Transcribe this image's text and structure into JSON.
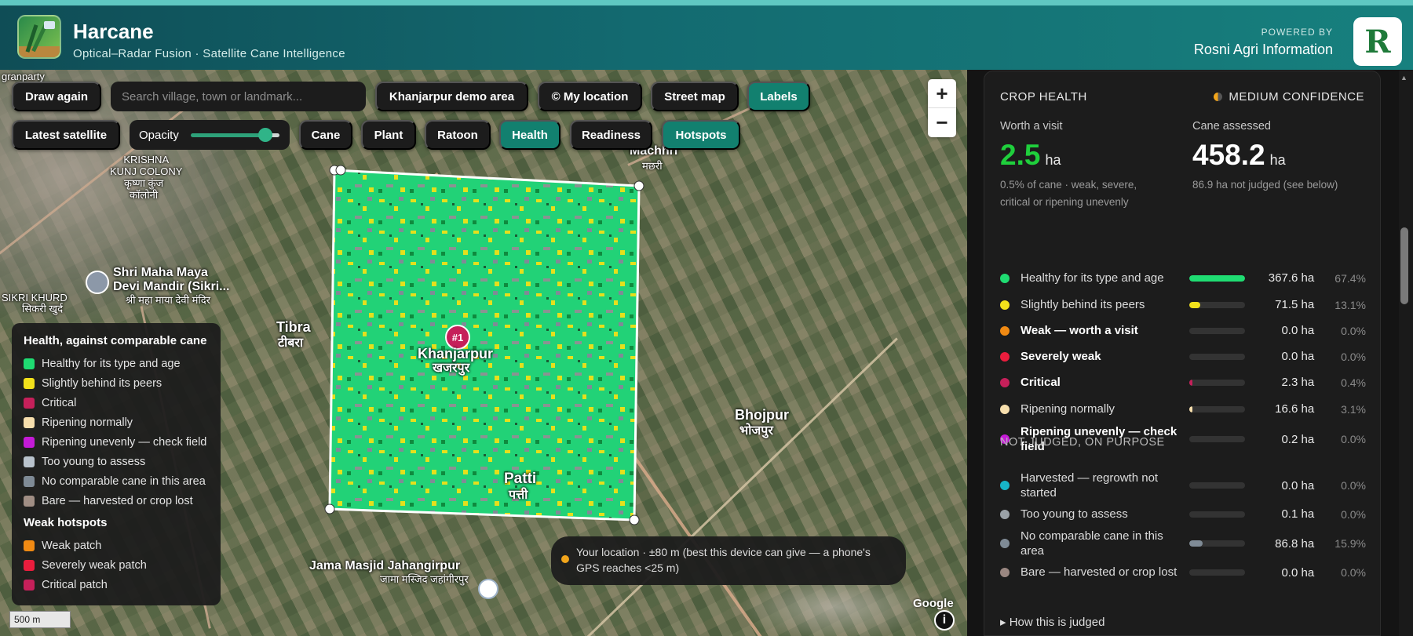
{
  "header": {
    "title": "Harcane",
    "subtitle": "Optical–Radar Fusion · Satellite Cane Intelligence",
    "powered_by": "POWERED BY",
    "company": "Rosni Agri Information",
    "brand_mark": "R"
  },
  "toolbar": {
    "draw_again": "Draw again",
    "search_placeholder": "Search village, town or landmark...",
    "demo_area": "Khanjarpur demo area",
    "my_location": "© My location",
    "street_map": "Street map",
    "labels": "Labels",
    "latest_satellite": "Latest satellite",
    "opacity_label": "Opacity",
    "opacity_value": 0.85,
    "layers": [
      "Cane",
      "Plant",
      "Ratoon",
      "Health",
      "Readiness",
      "Hotspots"
    ],
    "active_layers": [
      "Labels",
      "Health",
      "Hotspots"
    ]
  },
  "zoom": {
    "in": "+",
    "out": "−"
  },
  "legend": {
    "title": "Health, against comparable cane",
    "items": [
      {
        "label": "Healthy for its type and age",
        "color": "#1fdc72"
      },
      {
        "label": "Slightly behind its peers",
        "color": "#f2e11b"
      },
      {
        "label": "Critical",
        "color": "#c5205a"
      },
      {
        "label": "Ripening normally",
        "color": "#f7dfad"
      },
      {
        "label": "Ripening unevenly — check field",
        "color": "#c41bd6"
      },
      {
        "label": "Too young to assess",
        "color": "#b9c3cc"
      },
      {
        "label": "No comparable cane in this area",
        "color": "#7f8b96"
      },
      {
        "label": "Bare — harvested or crop lost",
        "color": "#a08e84"
      }
    ],
    "hotspots_title": "Weak hotspots",
    "hotspots": [
      {
        "label": "Weak patch",
        "color": "#f08a13"
      },
      {
        "label": "Severely weak patch",
        "color": "#ea1d3d"
      },
      {
        "label": "Critical patch",
        "color": "#c5205a"
      }
    ]
  },
  "map_labels": {
    "granparty": "granparty",
    "krishna": "KRISHNA\nKUNJ COLONY",
    "krishna_hi": "कृष्णा कुंज\nकॉलोनी",
    "machhri": "Machhri",
    "machhri_hi": "मछरी",
    "shrimaha": "Shri Maha Maya\nDevi Mandir (Sikri...",
    "shrimaha_hi": "श्री महा माया देवी मंदिर",
    "sikri": "SIKRI KHURD",
    "sikri_hi": "सिकरी खुर्द",
    "tibra": "Tibra",
    "tibra_hi": "टीबरा",
    "khanjarpur": "Khanjarpur",
    "khanjarpur_hi": "खजरपुर",
    "patti": "Patti",
    "patti_hi": "पत्ती",
    "bhojpur": "Bhojpur",
    "bhojpur_hi": "भोजपुर",
    "jama": "Jama Masjid Jahangirpur",
    "jama_hi": "जामा मस्जिद जहांगीरपुर",
    "scale": "500 m",
    "google": "Google",
    "hotspot": "#1"
  },
  "toast": "Your location · ±80 m (best this device can give — a phone's GPS reaches <25 m)",
  "panel": {
    "title": "CROP HEALTH",
    "confidence": "MEDIUM CONFIDENCE",
    "worth_label": "Worth a visit",
    "worth_value": "2.5",
    "worth_unit": "ha",
    "worth_note": "0.5% of cane · weak, severe, critical or ripening unevenly",
    "assessed_label": "Cane assessed",
    "assessed_value": "458.2",
    "assessed_unit": "ha",
    "assessed_note": "86.9 ha not judged (see below)",
    "rows": [
      {
        "label": "Healthy for its type and age",
        "bold": false,
        "color": "#1fdc72",
        "ha": "367.6 ha",
        "pct": "67.4%",
        "fill": 0.674
      },
      {
        "label": "Slightly behind its peers",
        "bold": false,
        "color": "#f2e11b",
        "ha": "71.5 ha",
        "pct": "13.1%",
        "fill": 0.131
      },
      {
        "label": "Weak — worth a visit",
        "bold": true,
        "color": "#f08a13",
        "ha": "0.0 ha",
        "pct": "0.0%",
        "fill": 0
      },
      {
        "label": "Severely weak",
        "bold": true,
        "color": "#ea1d3d",
        "ha": "0.0 ha",
        "pct": "0.0%",
        "fill": 0
      },
      {
        "label": "Critical",
        "bold": true,
        "color": "#c5205a",
        "ha": "2.3 ha",
        "pct": "0.4%",
        "fill": 0.004
      },
      {
        "label": "Ripening normally",
        "bold": false,
        "color": "#f7dfad",
        "ha": "16.6 ha",
        "pct": "3.1%",
        "fill": 0.031
      },
      {
        "label": "Ripening unevenly — check field",
        "bold": true,
        "color": "#c41bd6",
        "ha": "0.2 ha",
        "pct": "0.0%",
        "fill": 0
      }
    ],
    "not_judged_title": "NOT JUDGED, ON PURPOSE",
    "not_judged": [
      {
        "label": "Harvested — regrowth not started",
        "color": "#17b4c8",
        "ha": "0.0 ha",
        "pct": "0.0%",
        "fill": 0
      },
      {
        "label": "Too young to assess",
        "color": "#9aa1a7",
        "ha": "0.1 ha",
        "pct": "0.0%",
        "fill": 0
      },
      {
        "label": "No comparable cane in this area",
        "color": "#7f8b96",
        "ha": "86.8 ha",
        "pct": "15.9%",
        "fill": 0.159
      },
      {
        "label": "Bare — harvested or crop lost",
        "color": "#9a8781",
        "ha": "0.0 ha",
        "pct": "0.0%",
        "fill": 0
      }
    ],
    "how_judged": "▸ How this is judged"
  }
}
